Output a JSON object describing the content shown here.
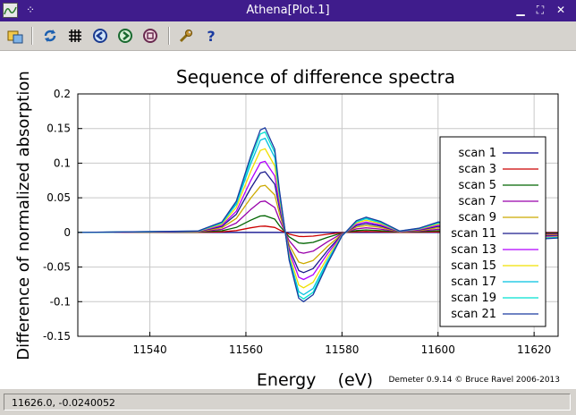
{
  "window": {
    "title": "Athena[Plot.1]"
  },
  "toolbar": {
    "buttons": [
      "save-image",
      "refresh",
      "grid",
      "zoom-in",
      "zoom-out",
      "zoom-reset",
      "configure",
      "help"
    ]
  },
  "status": {
    "text": "11626.0, -0.0240052"
  },
  "footer": {
    "credit": "Demeter 0.9.14 © Bruce Ravel 2006-2013"
  },
  "chart_data": {
    "type": "line",
    "title": "Sequence of difference spectra",
    "xlabel": "Energy    (eV)",
    "ylabel": "Difference of normalized absorption",
    "xlim": [
      11525,
      11625
    ],
    "ylim": [
      -0.15,
      0.2
    ],
    "xticks": [
      11540,
      11560,
      11580,
      11600,
      11620
    ],
    "yticks": [
      -0.15,
      -0.1,
      -0.05,
      0,
      0.05,
      0.1,
      0.15,
      0.2
    ],
    "grid": true,
    "legend_position": "right",
    "series": [
      {
        "name": "scan 1",
        "color": "#00008b",
        "scale": 0.0
      },
      {
        "name": "scan 3",
        "color": "#cc0000",
        "scale": 0.06
      },
      {
        "name": "scan 5",
        "color": "#006400",
        "scale": 0.16
      },
      {
        "name": "scan 7",
        "color": "#9900aa",
        "scale": 0.3
      },
      {
        "name": "scan 9",
        "color": "#ccaa00",
        "scale": 0.45
      },
      {
        "name": "scan 11",
        "color": "#1a1a8c",
        "scale": 0.58
      },
      {
        "name": "scan 13",
        "color": "#b000ff",
        "scale": 0.68
      },
      {
        "name": "scan 15",
        "color": "#f0e000",
        "scale": 0.8
      },
      {
        "name": "scan 17",
        "color": "#00c0e0",
        "scale": 0.9
      },
      {
        "name": "scan 19",
        "color": "#00e0d0",
        "scale": 0.96
      },
      {
        "name": "scan 21",
        "color": "#1a3aa0",
        "scale": 1.0
      }
    ],
    "peak_shape": {
      "x": [
        11525,
        11550,
        11555,
        11558,
        11561,
        11563,
        11564,
        11566,
        11567,
        11569,
        11571,
        11572,
        11574,
        11577,
        11580,
        11581,
        11583,
        11585,
        11588,
        11592,
        11596,
        11600,
        11605,
        11610,
        11615,
        11620,
        11625
      ],
      "y": [
        0,
        0.002,
        0.015,
        0.045,
        0.11,
        0.148,
        0.151,
        0.12,
        0.06,
        -0.04,
        -0.095,
        -0.1,
        -0.09,
        -0.045,
        -0.005,
        0.002,
        0.017,
        0.022,
        0.016,
        0.002,
        0.006,
        0.015,
        0.012,
        0.002,
        -0.005,
        -0.01,
        -0.008
      ]
    }
  }
}
